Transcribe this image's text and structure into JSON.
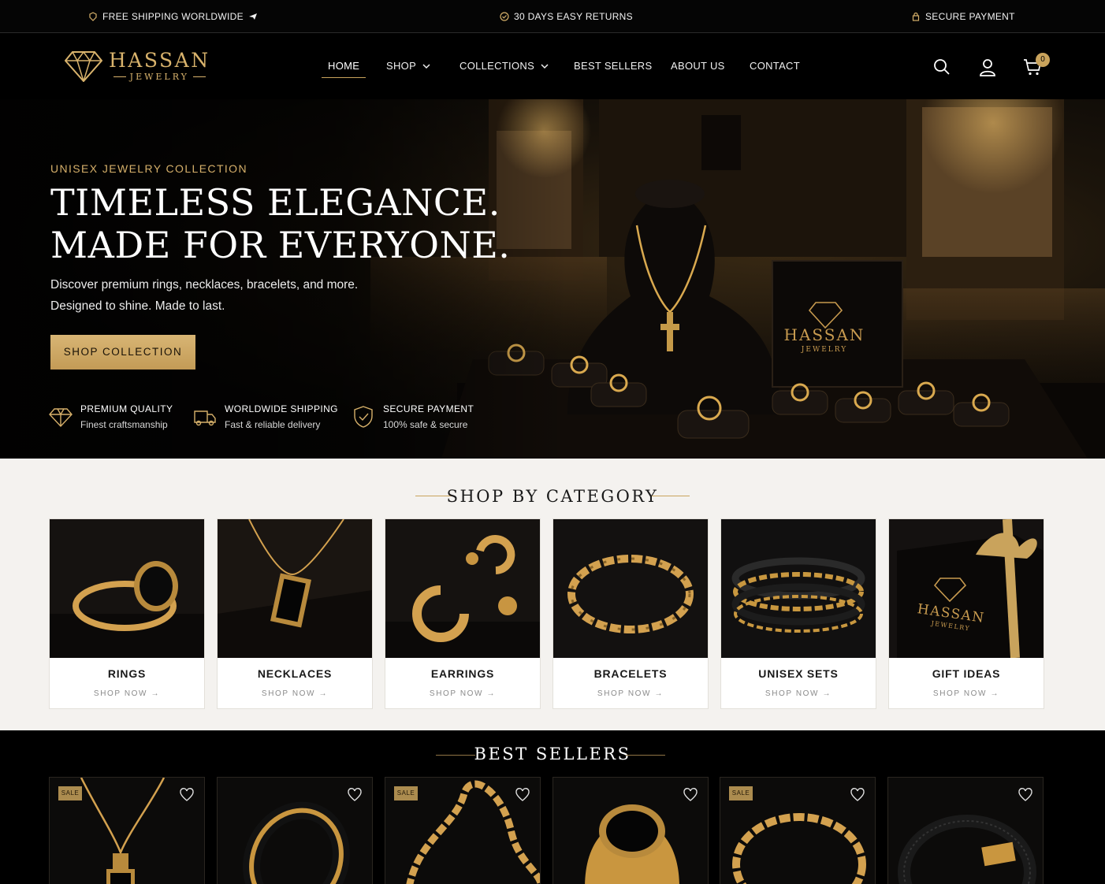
{
  "topbar": {
    "shipping": "FREE SHIPPING WORLDWIDE",
    "returns": "30 DAYS EASY RETURNS",
    "payment": "SECURE PAYMENT"
  },
  "brand": {
    "name": "HASSAN",
    "sub": "JEWELRY"
  },
  "nav": {
    "items": [
      "HOME",
      "SHOP",
      "COLLECTIONS",
      "BEST SELLERS",
      "ABOUT US",
      "CONTACT"
    ],
    "active": "HOME",
    "cart_count": "0"
  },
  "hero": {
    "eyebrow": "UNISEX JEWELRY COLLECTION",
    "title_line1": "TIMELESS ELEGANCE.",
    "title_line2": "MADE FOR EVERYONE.",
    "desc_line1": "Discover premium rings, necklaces, bracelets, and more.",
    "desc_line2": "Designed to shine. Made to last.",
    "cta": "SHOP COLLECTION",
    "display_brand": "HASSAN",
    "display_sub": "JEWELRY",
    "features": [
      {
        "title": "PREMIUM QUALITY",
        "sub": "Finest craftsmanship",
        "icon": "diamond-icon"
      },
      {
        "title": "WORLDWIDE SHIPPING",
        "sub": "Fast & reliable delivery",
        "icon": "truck-icon"
      },
      {
        "title": "SECURE PAYMENT",
        "sub": "100% safe & secure",
        "icon": "shield-check-icon"
      }
    ]
  },
  "categories": {
    "title": "SHOP BY CATEGORY",
    "shop_label": "SHOP NOW →",
    "gift_box_brand": "HASSAN",
    "gift_box_sub": "JEWELRY",
    "items": [
      {
        "name": "RINGS"
      },
      {
        "name": "NECKLACES"
      },
      {
        "name": "EARRINGS"
      },
      {
        "name": "BRACELETS"
      },
      {
        "name": "UNISEX SETS"
      },
      {
        "name": "GIFT IDEAS"
      }
    ]
  },
  "bestsellers": {
    "title": "BEST SELLERS",
    "sale_label": "SALE",
    "products": [
      {
        "sale": true
      },
      {
        "sale": false
      },
      {
        "sale": true
      },
      {
        "sale": false
      },
      {
        "sale": true
      },
      {
        "sale": false
      }
    ]
  },
  "colors": {
    "gold": "#c9a35c",
    "dark": "#000000",
    "cream": "#f4f2ef"
  }
}
